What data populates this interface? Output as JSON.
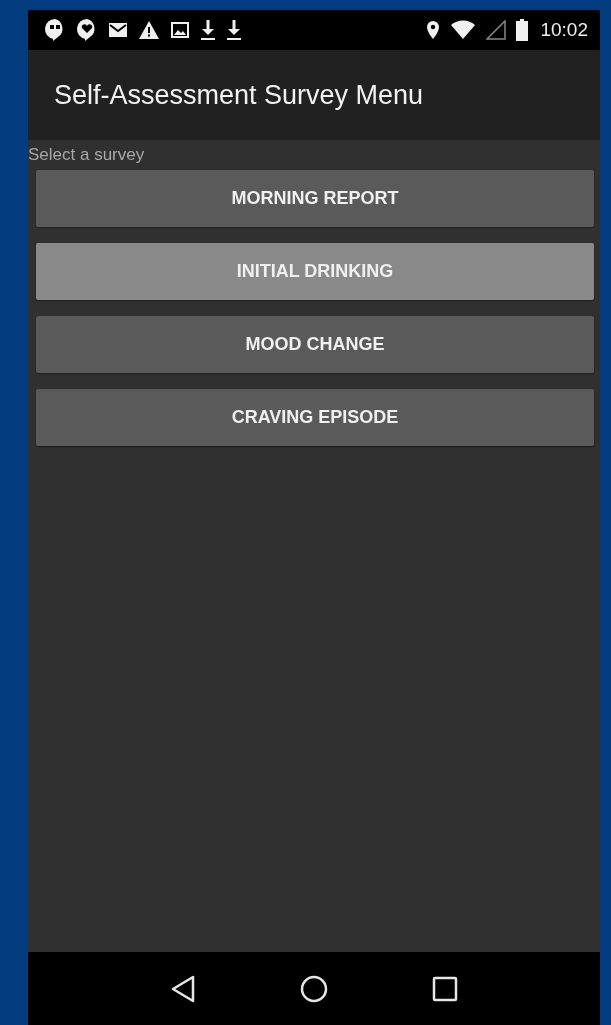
{
  "status_bar": {
    "time": "10:02"
  },
  "app_bar": {
    "title": "Self-Assessment Survey Menu"
  },
  "prompt": "Select a survey",
  "surveys": [
    {
      "label": "MORNING REPORT",
      "selected": false
    },
    {
      "label": "INITIAL DRINKING",
      "selected": true
    },
    {
      "label": "MOOD CHANGE",
      "selected": false
    },
    {
      "label": "CRAVING EPISODE",
      "selected": false
    }
  ]
}
